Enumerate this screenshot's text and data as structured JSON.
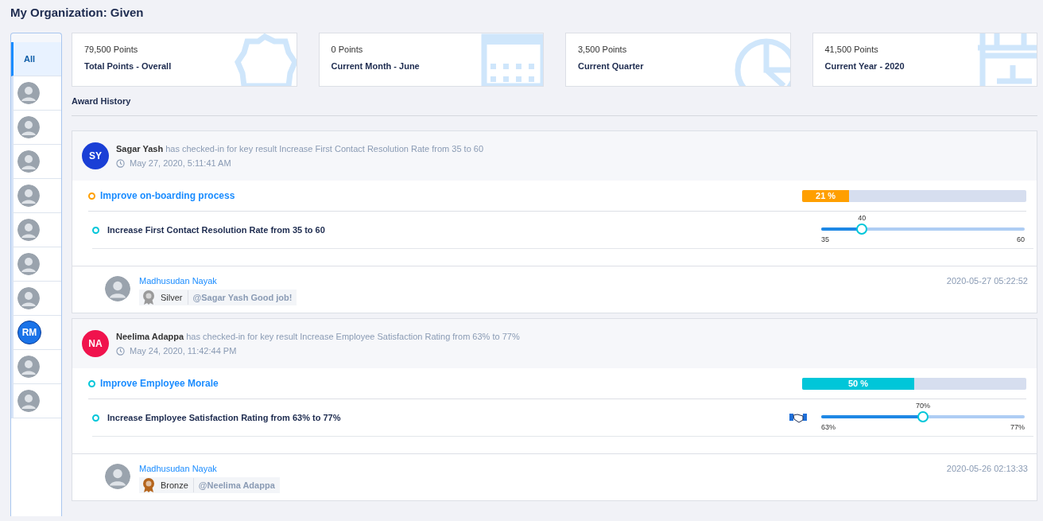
{
  "page": {
    "title": "My Organization: Given"
  },
  "sidebar": {
    "items": [
      {
        "kind": "label",
        "label": "All",
        "selected": true
      },
      {
        "kind": "photo",
        "selected": false
      },
      {
        "kind": "photo",
        "selected": false
      },
      {
        "kind": "photo",
        "selected": false
      },
      {
        "kind": "photo",
        "selected": false
      },
      {
        "kind": "photo",
        "selected": false
      },
      {
        "kind": "photo",
        "selected": false
      },
      {
        "kind": "photo",
        "selected": false
      },
      {
        "kind": "initials",
        "label": "RM",
        "color": "#1a73e8",
        "selected": false
      },
      {
        "kind": "photo",
        "selected": false
      },
      {
        "kind": "photo",
        "selected": false
      }
    ]
  },
  "stats": [
    {
      "kind": "badge",
      "value": "79,500 Points",
      "label": "Total Points - Overall"
    },
    {
      "kind": "calendar",
      "value": "0 Points",
      "label": "Current Month - June"
    },
    {
      "kind": "pie",
      "value": "3,500 Points",
      "label": "Current Quarter"
    },
    {
      "kind": "year",
      "value": "41,500 Points",
      "label": "Current Year - 2020"
    }
  ],
  "award_history": {
    "title": "Award History",
    "entries": [
      {
        "initials": "SY",
        "color": "#1a3fd6",
        "name": "Sagar Yash",
        "action": "has checked-in for key result Increase First Contact Resolution Rate from 35 to 60",
        "time": "May 27, 2020, 5:11:41 AM",
        "objective": {
          "title": "Improve on-boarding process",
          "color": "#ff9f00",
          "level": 0.21,
          "progress": "21 %"
        },
        "key_result": {
          "title": "Increase First Contact Resolution Rate from 35 to 60",
          "shared": false,
          "level": 0.2,
          "current": "40",
          "min": "35",
          "max": "60"
        },
        "award": {
          "giver": "Madhusudan Nayak",
          "medal": "Silver",
          "color": "#9a9a9a",
          "message": "@Sagar Yash Good job!",
          "timestamp": "2020-05-27 05:22:52"
        }
      },
      {
        "initials": "NA",
        "color": "#f0134d",
        "name": "Neelima Adappa",
        "action": "has checked-in for key result Increase Employee Satisfaction Rating from 63% to 77%",
        "time": "May 24, 2020, 11:42:44 PM",
        "objective": {
          "title": "Improve Employee Morale",
          "color": "#00c6d9",
          "level": 0.5,
          "progress": "50 %"
        },
        "key_result": {
          "title": "Increase Employee Satisfaction Rating from 63% to 77%",
          "shared": true,
          "level": 0.5,
          "current": "70%",
          "min": "63%",
          "max": "77%"
        },
        "award": {
          "giver": "Madhusudan Nayak",
          "medal": "Bronze",
          "color": "#b5651d",
          "message": "@Neelima Adappa",
          "timestamp": "2020-05-26 02:13:33"
        }
      }
    ]
  }
}
